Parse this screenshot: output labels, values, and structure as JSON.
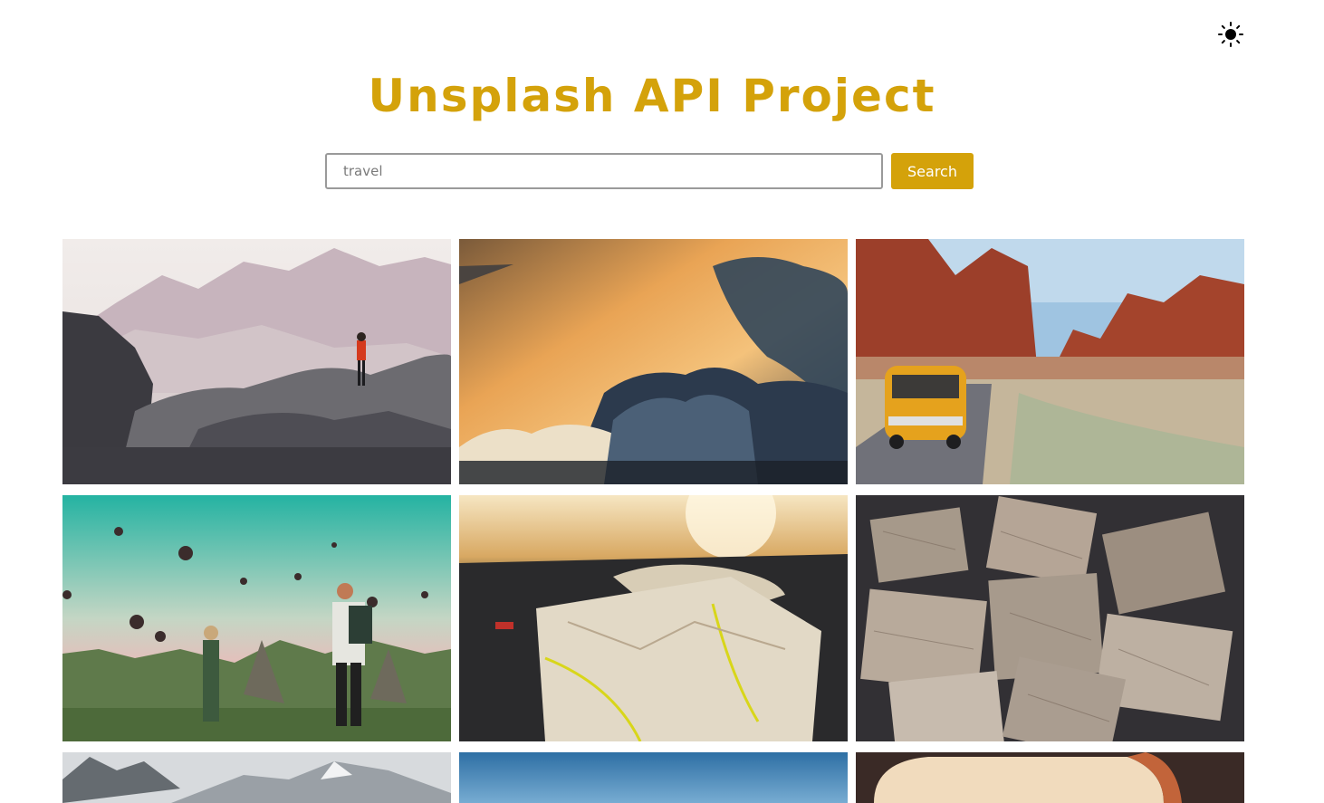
{
  "header": {
    "title": "Unsplash API Project",
    "theme_toggle_icon": "sun-icon"
  },
  "search": {
    "value": "travel",
    "button_label": "Search"
  },
  "gallery": {
    "columns": 3,
    "photos": [
      {
        "subject": "mountain-hiker"
      },
      {
        "subject": "clouds-from-plane"
      },
      {
        "subject": "canyon-van-road"
      },
      {
        "subject": "balloons-couple"
      },
      {
        "subject": "dashboard-map"
      },
      {
        "subject": "scattered-maps"
      },
      {
        "subject": "snowy-mountains"
      },
      {
        "subject": "blue-sky"
      },
      {
        "subject": "blurred-warm"
      }
    ]
  },
  "colors": {
    "accent": "#d4a20a",
    "text_on_accent": "#ffffff"
  }
}
